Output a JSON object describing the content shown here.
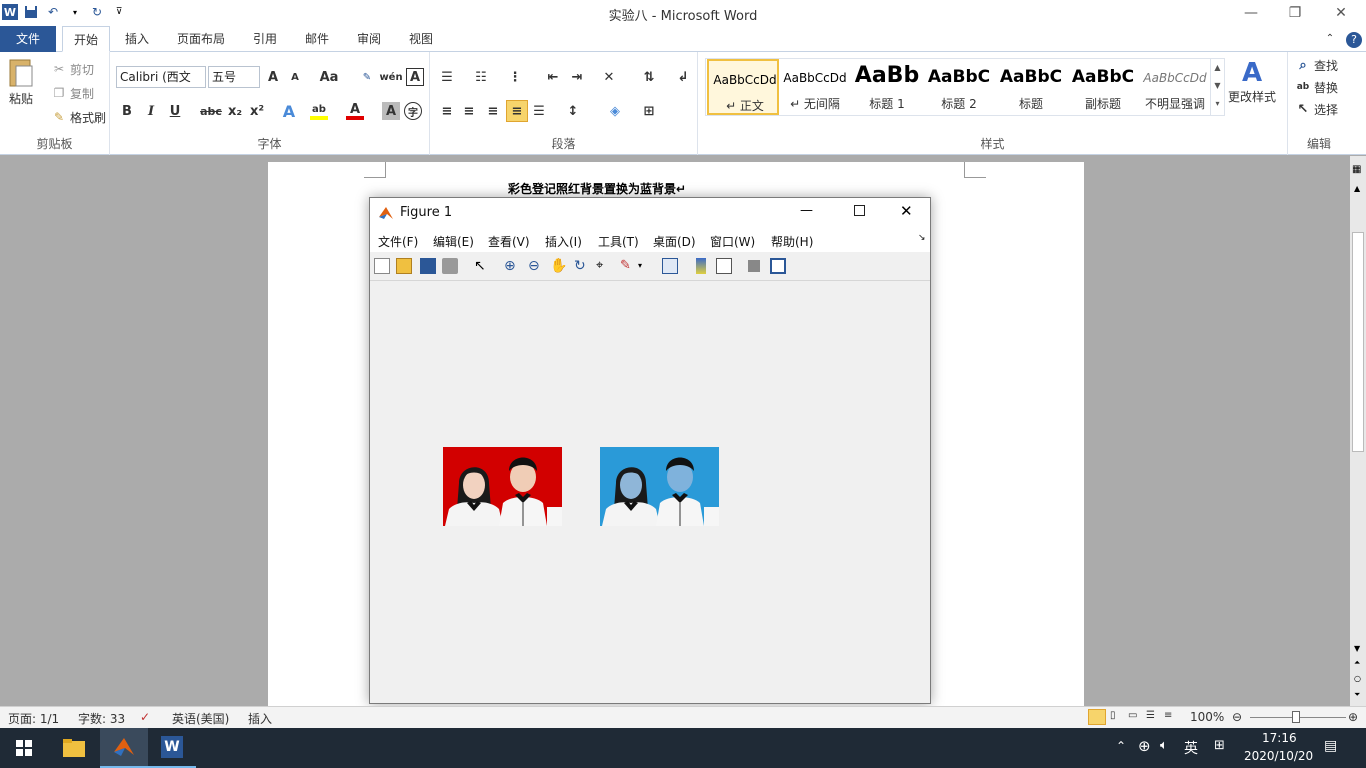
{
  "window": {
    "title": "实验八 - Microsoft Word"
  },
  "tabs": [
    "文件",
    "开始",
    "插入",
    "页面布局",
    "引用",
    "邮件",
    "审阅",
    "视图"
  ],
  "clipboard": {
    "paste": "粘贴",
    "cut": "剪切",
    "copy": "复制",
    "format_painter": "格式刷",
    "label": "剪贴板"
  },
  "font": {
    "name": "Calibri (西文",
    "size": "五号",
    "label": "字体",
    "change_case": "Aa"
  },
  "paragraph": {
    "label": "段落"
  },
  "styles": {
    "label": "样式",
    "items": [
      {
        "sample": "AaBbCcDd",
        "name": "↵ 正文"
      },
      {
        "sample": "AaBbCcDd",
        "name": "↵ 无间隔"
      },
      {
        "sample": "AaBb",
        "name": "标题 1"
      },
      {
        "sample": "AaBbC",
        "name": "标题 2"
      },
      {
        "sample": "AaBbC",
        "name": "标题"
      },
      {
        "sample": "AaBbC",
        "name": "副标题"
      },
      {
        "sample": "AaBbCcDd",
        "name": "不明显强调"
      }
    ],
    "change_styles": "更改样式"
  },
  "editing": {
    "find": "查找",
    "replace": "替换",
    "select": "选择",
    "label": "编辑"
  },
  "document": {
    "heading": "彩色登记照红背景置换为蓝背景↵"
  },
  "figure": {
    "title": "Figure 1",
    "menu": [
      "文件(F)",
      "编辑(E)",
      "查看(V)",
      "插入(I)",
      "工具(T)",
      "桌面(D)",
      "窗口(W)",
      "帮助(H)"
    ]
  },
  "status": {
    "page": "页面: 1/1",
    "words": "字数: 33",
    "language": "英语(美国)",
    "mode": "插入",
    "zoom": "100%"
  },
  "tray": {
    "time": "17:16",
    "date": "2020/10/20",
    "ime": "英"
  },
  "colors": {
    "accent": "#2b5797",
    "red_bg": "#d20000",
    "blue_bg": "#2a9ad8"
  }
}
